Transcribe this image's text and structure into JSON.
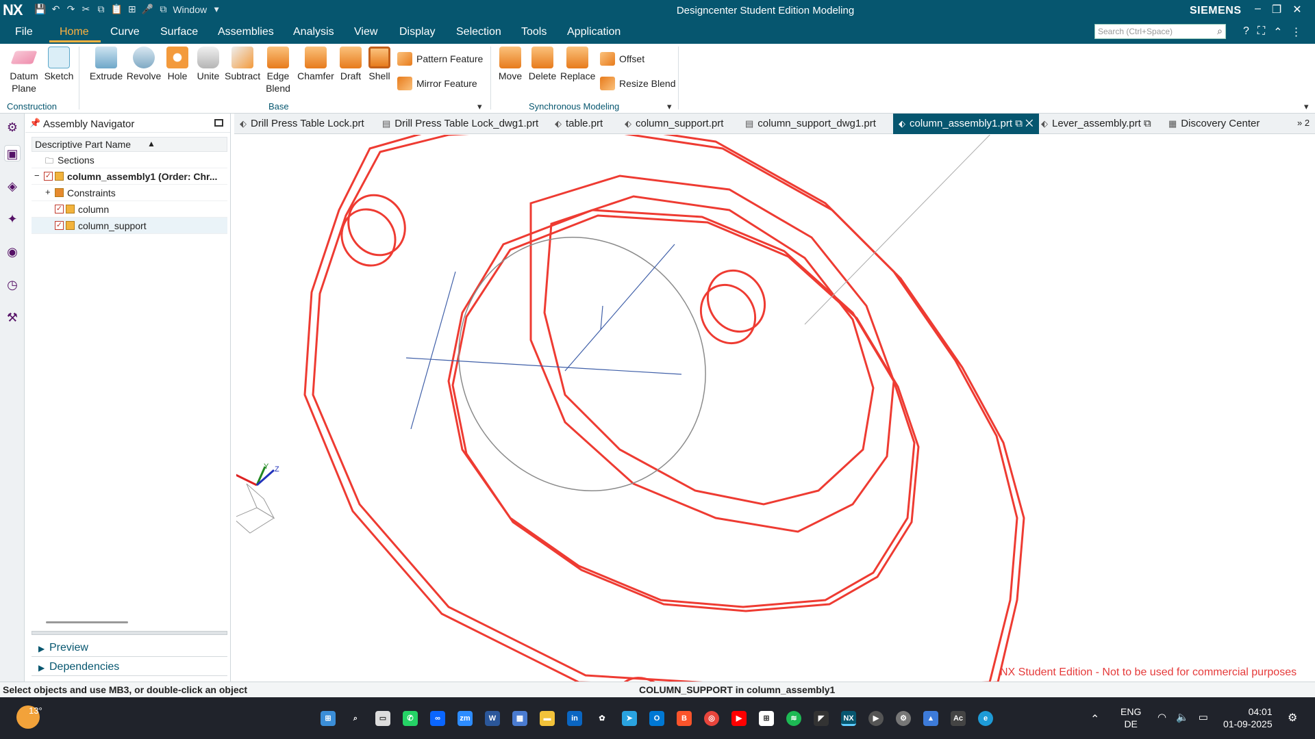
{
  "titlebar": {
    "logo": "NX",
    "title": "Designcenter Student Edition Modeling",
    "brand": "SIEMENS",
    "window_menu": "Window"
  },
  "menu": {
    "tabs": [
      "File",
      "Home",
      "Curve",
      "Surface",
      "Assemblies",
      "Analysis",
      "View",
      "Display",
      "Selection",
      "Tools",
      "Application"
    ],
    "active": "Home",
    "search_placeholder": "Search (Ctrl+Space)"
  },
  "ribbon": {
    "datum_plane": "Datum Plane",
    "sketch": "Sketch",
    "extrude": "Extrude",
    "revolve": "Revolve",
    "hole": "Hole",
    "unite": "Unite",
    "subtract": "Subtract",
    "edge_blend": "Edge Blend",
    "chamfer": "Chamfer",
    "draft": "Draft",
    "shell": "Shell",
    "pattern_feature": "Pattern Feature",
    "mirror_feature": "Mirror Feature",
    "move": "Move",
    "delete": "Delete",
    "replace": "Replace",
    "offset": "Offset",
    "resize_blend": "Resize Blend",
    "group_construction": "Construction",
    "group_base": "Base",
    "group_sync": "Synchronous Modeling"
  },
  "navigator": {
    "title": "Assembly Navigator",
    "column_header": "Descriptive Part Name",
    "rows": [
      {
        "label": "Sections"
      },
      {
        "label": "column_assembly1 (Order: Chr..."
      },
      {
        "label": "Constraints"
      },
      {
        "label": "column"
      },
      {
        "label": "column_support"
      }
    ],
    "preview": "Preview",
    "dependencies": "Dependencies"
  },
  "doc_tabs": [
    "Drill Press Table Lock.prt",
    "Drill Press Table Lock_dwg1.prt",
    "table.prt",
    "column_support.prt",
    "column_support_dwg1.prt",
    "column_assembly1.prt",
    "Lever_assembly.prt",
    "Discovery Center"
  ],
  "doc_tabs_overflow": "» 2",
  "viewport": {
    "watermark": "NX Student Edition - Not to be used for commercial purposes",
    "axis_x": "X",
    "axis_y": "Y",
    "axis_z": "Z"
  },
  "status": {
    "left": "Select objects and use MB3, or double-click an object",
    "center": "COLUMN_SUPPORT in column_assembly1"
  },
  "taskbar": {
    "temperature": "13°",
    "lang1": "ENG",
    "lang2": "DE",
    "time": "04:01",
    "date": "01-09-2025"
  }
}
